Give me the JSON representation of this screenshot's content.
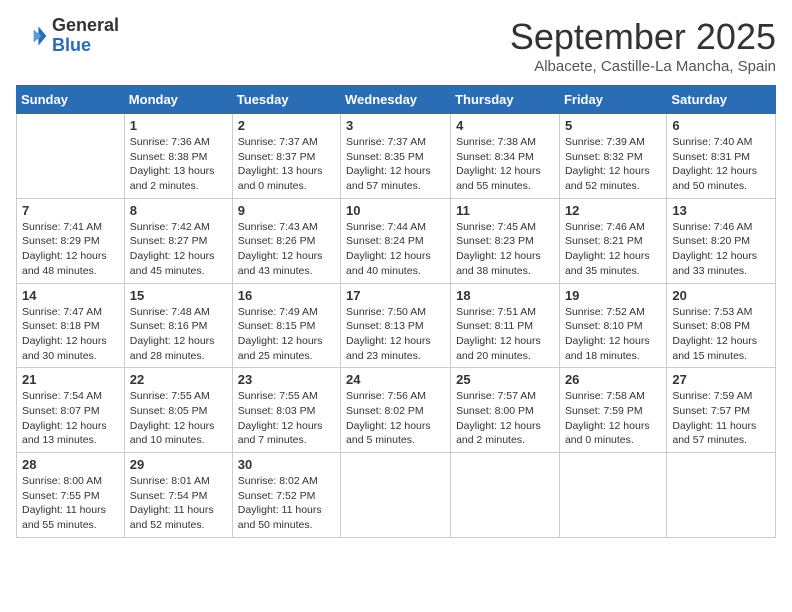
{
  "logo": {
    "general": "General",
    "blue": "Blue"
  },
  "title": "September 2025",
  "location": "Albacete, Castille-La Mancha, Spain",
  "days_of_week": [
    "Sunday",
    "Monday",
    "Tuesday",
    "Wednesday",
    "Thursday",
    "Friday",
    "Saturday"
  ],
  "weeks": [
    [
      {
        "day": "",
        "info": ""
      },
      {
        "day": "1",
        "info": "Sunrise: 7:36 AM\nSunset: 8:38 PM\nDaylight: 13 hours\nand 2 minutes."
      },
      {
        "day": "2",
        "info": "Sunrise: 7:37 AM\nSunset: 8:37 PM\nDaylight: 13 hours\nand 0 minutes."
      },
      {
        "day": "3",
        "info": "Sunrise: 7:37 AM\nSunset: 8:35 PM\nDaylight: 12 hours\nand 57 minutes."
      },
      {
        "day": "4",
        "info": "Sunrise: 7:38 AM\nSunset: 8:34 PM\nDaylight: 12 hours\nand 55 minutes."
      },
      {
        "day": "5",
        "info": "Sunrise: 7:39 AM\nSunset: 8:32 PM\nDaylight: 12 hours\nand 52 minutes."
      },
      {
        "day": "6",
        "info": "Sunrise: 7:40 AM\nSunset: 8:31 PM\nDaylight: 12 hours\nand 50 minutes."
      }
    ],
    [
      {
        "day": "7",
        "info": "Sunrise: 7:41 AM\nSunset: 8:29 PM\nDaylight: 12 hours\nand 48 minutes."
      },
      {
        "day": "8",
        "info": "Sunrise: 7:42 AM\nSunset: 8:27 PM\nDaylight: 12 hours\nand 45 minutes."
      },
      {
        "day": "9",
        "info": "Sunrise: 7:43 AM\nSunset: 8:26 PM\nDaylight: 12 hours\nand 43 minutes."
      },
      {
        "day": "10",
        "info": "Sunrise: 7:44 AM\nSunset: 8:24 PM\nDaylight: 12 hours\nand 40 minutes."
      },
      {
        "day": "11",
        "info": "Sunrise: 7:45 AM\nSunset: 8:23 PM\nDaylight: 12 hours\nand 38 minutes."
      },
      {
        "day": "12",
        "info": "Sunrise: 7:46 AM\nSunset: 8:21 PM\nDaylight: 12 hours\nand 35 minutes."
      },
      {
        "day": "13",
        "info": "Sunrise: 7:46 AM\nSunset: 8:20 PM\nDaylight: 12 hours\nand 33 minutes."
      }
    ],
    [
      {
        "day": "14",
        "info": "Sunrise: 7:47 AM\nSunset: 8:18 PM\nDaylight: 12 hours\nand 30 minutes."
      },
      {
        "day": "15",
        "info": "Sunrise: 7:48 AM\nSunset: 8:16 PM\nDaylight: 12 hours\nand 28 minutes."
      },
      {
        "day": "16",
        "info": "Sunrise: 7:49 AM\nSunset: 8:15 PM\nDaylight: 12 hours\nand 25 minutes."
      },
      {
        "day": "17",
        "info": "Sunrise: 7:50 AM\nSunset: 8:13 PM\nDaylight: 12 hours\nand 23 minutes."
      },
      {
        "day": "18",
        "info": "Sunrise: 7:51 AM\nSunset: 8:11 PM\nDaylight: 12 hours\nand 20 minutes."
      },
      {
        "day": "19",
        "info": "Sunrise: 7:52 AM\nSunset: 8:10 PM\nDaylight: 12 hours\nand 18 minutes."
      },
      {
        "day": "20",
        "info": "Sunrise: 7:53 AM\nSunset: 8:08 PM\nDaylight: 12 hours\nand 15 minutes."
      }
    ],
    [
      {
        "day": "21",
        "info": "Sunrise: 7:54 AM\nSunset: 8:07 PM\nDaylight: 12 hours\nand 13 minutes."
      },
      {
        "day": "22",
        "info": "Sunrise: 7:55 AM\nSunset: 8:05 PM\nDaylight: 12 hours\nand 10 minutes."
      },
      {
        "day": "23",
        "info": "Sunrise: 7:55 AM\nSunset: 8:03 PM\nDaylight: 12 hours\nand 7 minutes."
      },
      {
        "day": "24",
        "info": "Sunrise: 7:56 AM\nSunset: 8:02 PM\nDaylight: 12 hours\nand 5 minutes."
      },
      {
        "day": "25",
        "info": "Sunrise: 7:57 AM\nSunset: 8:00 PM\nDaylight: 12 hours\nand 2 minutes."
      },
      {
        "day": "26",
        "info": "Sunrise: 7:58 AM\nSunset: 7:59 PM\nDaylight: 12 hours\nand 0 minutes."
      },
      {
        "day": "27",
        "info": "Sunrise: 7:59 AM\nSunset: 7:57 PM\nDaylight: 11 hours\nand 57 minutes."
      }
    ],
    [
      {
        "day": "28",
        "info": "Sunrise: 8:00 AM\nSunset: 7:55 PM\nDaylight: 11 hours\nand 55 minutes."
      },
      {
        "day": "29",
        "info": "Sunrise: 8:01 AM\nSunset: 7:54 PM\nDaylight: 11 hours\nand 52 minutes."
      },
      {
        "day": "30",
        "info": "Sunrise: 8:02 AM\nSunset: 7:52 PM\nDaylight: 11 hours\nand 50 minutes."
      },
      {
        "day": "",
        "info": ""
      },
      {
        "day": "",
        "info": ""
      },
      {
        "day": "",
        "info": ""
      },
      {
        "day": "",
        "info": ""
      }
    ]
  ]
}
